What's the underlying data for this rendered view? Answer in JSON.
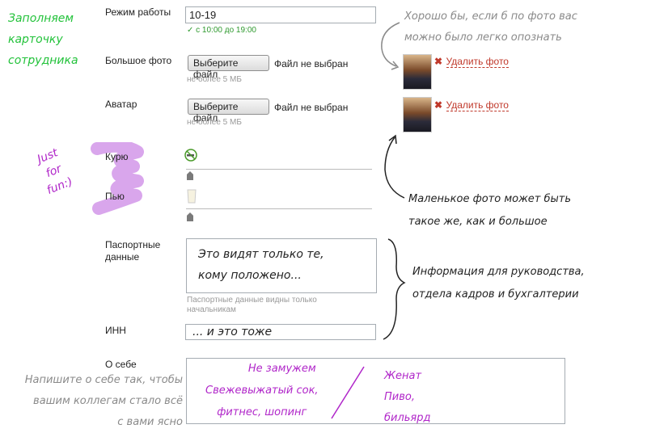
{
  "left_note": [
    "Заполняем",
    "карточку",
    "сотрудника"
  ],
  "fun_note": [
    "Just",
    "for",
    "fun:)"
  ],
  "work_mode": {
    "label": "Режим работы",
    "value": "10-19",
    "check": "✓ с 10:00 до 19:00"
  },
  "big_photo": {
    "label": "Большое фото",
    "button": "Выберите файл",
    "status": "Файл не выбран",
    "hint": "не более 5 МБ",
    "delete": "Удалить фото"
  },
  "avatar": {
    "label": "Аватар",
    "button": "Выберите файл",
    "status": "Файл не выбран",
    "hint": "не более 5 МБ",
    "delete": "Удалить фото"
  },
  "smoke": {
    "label": "Курю"
  },
  "drink": {
    "label": "Пью"
  },
  "passport": {
    "label": [
      "Паспортные",
      "данные"
    ],
    "text": [
      "Это видят только те,",
      "кому положено..."
    ],
    "hint": [
      "Паспортные данные видны только",
      "начальникам"
    ]
  },
  "inn": {
    "label": "ИНН",
    "value": "... и это тоже"
  },
  "about": {
    "label": "О себе",
    "left_text": [
      "Не замужем",
      "Свежевыжатый сок,",
      "фитнес, шопинг"
    ],
    "right_text": [
      "Женат",
      "Пиво,",
      "бильярд"
    ]
  },
  "notes": {
    "photo_recognize": [
      "Хорошо бы, если б по фото вас",
      "можно было легко опознать"
    ],
    "small_photo": [
      "Маленькое фото может быть",
      "такое же, как и большое"
    ],
    "management": [
      "Информация для руководства,",
      "отдела кадров и бухгалтерии"
    ],
    "about_self": [
      "Напишите о себе так, чтобы",
      "вашим коллегам стало всё",
      "с вами ясно"
    ]
  },
  "colors": {
    "green_note": "#22c23a",
    "purple": "#b026c9",
    "grey_note": "#8a8a8a",
    "delete": "#c0392b",
    "check": "#2f9a2f"
  }
}
